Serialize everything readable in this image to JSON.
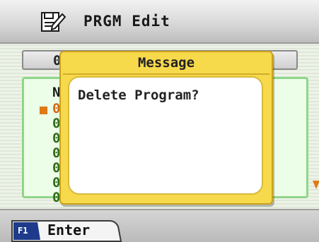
{
  "header": {
    "title": "PRGM Edit",
    "icon": "program-edit-icon"
  },
  "file_bar": {
    "text": "0"
  },
  "program_list": {
    "header": "N",
    "rows": [
      "0",
      "0",
      "0",
      "0",
      "0",
      "0",
      "0"
    ],
    "selected_index": 0
  },
  "dialog": {
    "title": "Message",
    "message": "Delete Program?"
  },
  "softkeys": [
    {
      "key": "F1",
      "label": "Enter"
    }
  ],
  "colors": {
    "dialog_bg": "#f7d94c",
    "list_bg": "#ecfde8",
    "list_border": "#8fd68a",
    "row_text": "#2f6b16",
    "selected": "#e07a16"
  }
}
